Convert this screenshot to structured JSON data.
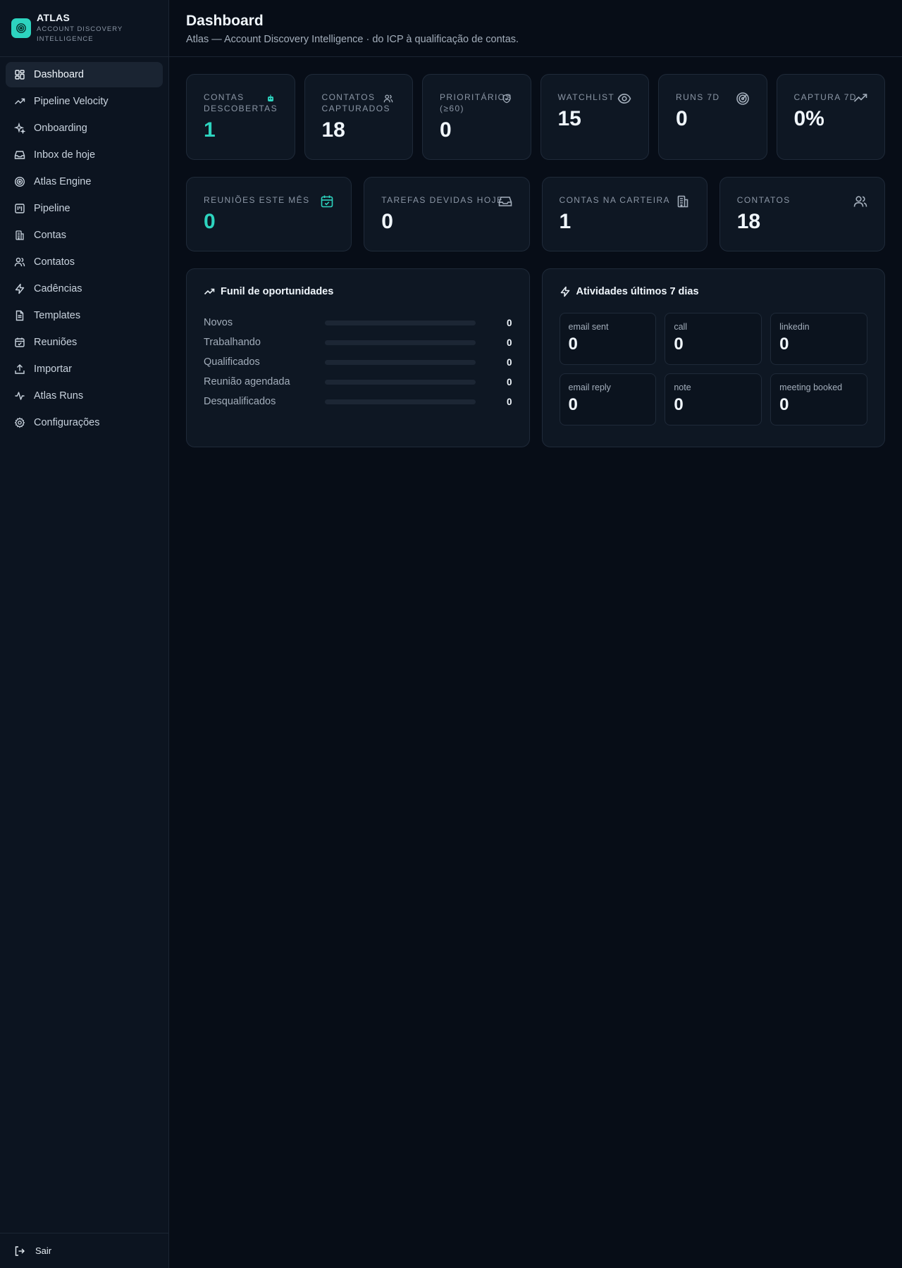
{
  "brand": {
    "title": "ATLAS",
    "subtitle": "ACCOUNT DISCOVERY INTELLIGENCE"
  },
  "sidebar": {
    "items": [
      {
        "label": "Dashboard",
        "icon": "dashboard-icon",
        "active": true
      },
      {
        "label": "Pipeline Velocity",
        "icon": "trending-up-icon"
      },
      {
        "label": "Onboarding",
        "icon": "sparkles-icon"
      },
      {
        "label": "Inbox de hoje",
        "icon": "inbox-icon"
      },
      {
        "label": "Atlas Engine",
        "icon": "target-icon"
      },
      {
        "label": "Pipeline",
        "icon": "kanban-icon"
      },
      {
        "label": "Contas",
        "icon": "building-icon"
      },
      {
        "label": "Contatos",
        "icon": "users-icon"
      },
      {
        "label": "Cadências",
        "icon": "zap-icon"
      },
      {
        "label": "Templates",
        "icon": "file-text-icon"
      },
      {
        "label": "Reuniões",
        "icon": "calendar-check-icon"
      },
      {
        "label": "Importar",
        "icon": "upload-icon"
      },
      {
        "label": "Atlas Runs",
        "icon": "activity-icon"
      },
      {
        "label": "Configurações",
        "icon": "gear-icon"
      }
    ],
    "logout_label": "Sair"
  },
  "header": {
    "title": "Dashboard",
    "subtitle": "Atlas — Account Discovery Intelligence · do ICP à qualificação de contas."
  },
  "stats_top": [
    {
      "label": "Contas descobertas",
      "value": "1",
      "accent": true,
      "icon": "bot-icon"
    },
    {
      "label": "Contatos capturados",
      "value": "18",
      "icon": "users-icon"
    },
    {
      "label": "Prioritários (≥60)",
      "value": "0",
      "icon": "shield-check-icon"
    },
    {
      "label": "Watchlist",
      "value": "15",
      "icon": "eye-icon"
    },
    {
      "label": "Runs 7d",
      "value": "0",
      "icon": "radar-icon"
    },
    {
      "label": "Captura 7d",
      "value": "0%",
      "icon": "trending-up-icon"
    }
  ],
  "stats_mid": [
    {
      "label": "Reuniões este mês",
      "value": "0",
      "accent": true,
      "icon": "calendar-check-icon"
    },
    {
      "label": "Tarefas devidas hoje",
      "value": "0",
      "icon": "inbox-icon"
    },
    {
      "label": "Contas na carteira",
      "value": "1",
      "icon": "building-icon"
    },
    {
      "label": "Contatos",
      "value": "18",
      "icon": "users-icon"
    }
  ],
  "funnel": {
    "title": "Funil de oportunidades",
    "rows": [
      {
        "label": "Novos",
        "count": "0",
        "fraction": 0
      },
      {
        "label": "Trabalhando",
        "count": "0",
        "fraction": 0
      },
      {
        "label": "Qualificados",
        "count": "0",
        "fraction": 0
      },
      {
        "label": "Reunião agendada",
        "count": "0",
        "fraction": 0
      },
      {
        "label": "Desqualificados",
        "count": "0",
        "fraction": 0
      }
    ]
  },
  "activities": {
    "title": "Atividades últimos 7 dias",
    "items": [
      {
        "label": "email sent",
        "value": "0"
      },
      {
        "label": "call",
        "value": "0"
      },
      {
        "label": "linkedin",
        "value": "0"
      },
      {
        "label": "email reply",
        "value": "0"
      },
      {
        "label": "note",
        "value": "0"
      },
      {
        "label": "meeting booked",
        "value": "0"
      }
    ]
  },
  "colors": {
    "accent": "#2dd4bf",
    "background": "#070d17",
    "card": "#0e1723"
  }
}
